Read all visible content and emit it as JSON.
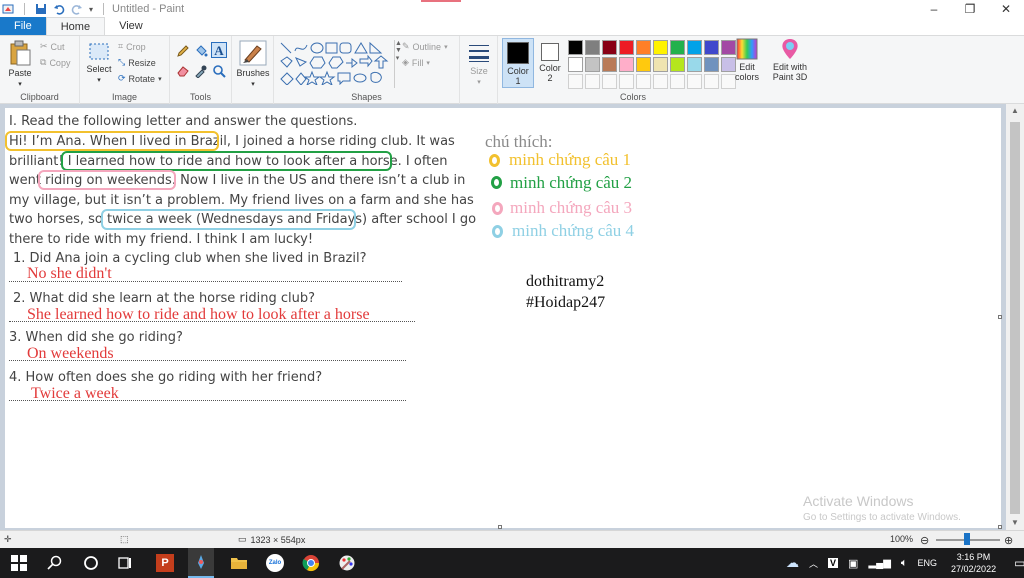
{
  "window": {
    "title": "Untitled - Paint"
  },
  "tabs": [
    {
      "label": "File"
    },
    {
      "label": "Home"
    },
    {
      "label": "View"
    }
  ],
  "ribbon": {
    "clipboard": {
      "label": "Clipboard",
      "paste": "Paste",
      "cut": "Cut",
      "copy": "Copy"
    },
    "image": {
      "label": "Image",
      "select": "Select",
      "crop": "Crop",
      "resize": "Resize",
      "rotate": "Rotate"
    },
    "tools": {
      "label": "Tools"
    },
    "brushes": {
      "label": "Brushes"
    },
    "shapes": {
      "label": "Shapes",
      "outline": "Outline",
      "fill": "Fill"
    },
    "size": {
      "label": "Size"
    },
    "colors": {
      "label": "Colors",
      "color1": "Color\n1",
      "color2": "Color\n2",
      "color1_value": "#000000",
      "color2_value": "#ffffff",
      "edit": "Edit\ncolors",
      "paint3d": "Edit with\nPaint 3D",
      "palette_row1": [
        "#000000",
        "#7f7f7f",
        "#880015",
        "#ed1c24",
        "#ff7f27",
        "#fff200",
        "#22b14c",
        "#00a2e8",
        "#3f48cc",
        "#a349a4"
      ],
      "palette_row2": [
        "#ffffff",
        "#c3c3c3",
        "#b97a57",
        "#ffaec9",
        "#ffc90e",
        "#efe4b0",
        "#b5e61d",
        "#99d9ea",
        "#7092be",
        "#c8bfe7"
      ]
    }
  },
  "document": {
    "lines": [
      "I. Read the following letter and answer the questions.",
      "Hi! I’m Ana. When I lived in Brazil, I joined a horse riding club. It was",
      "brilliant! I learned how to ride and how to look after a horse. I often",
      "went riding on weekends. Now I live in the US and there isn’t a club in",
      "my village, but it isn’t a problem. My friend lives on a farm and she has",
      "two horses, so twice a week (Wednesdays and Fridays) after school I go",
      "there to ride with my friend. I think I am lucky!"
    ],
    "questions": [
      {
        "q": "1. Did Ana join a cycling club when she lived in Brazil?",
        "a": "No she didn't"
      },
      {
        "q": "2. What did she learn at the horse riding club?",
        "a": "She learned how to ride and how to look after a horse"
      },
      {
        "q": "3. When did she go riding?",
        "a": "On weekends"
      },
      {
        "q": "4. How often does she go riding with her friend?",
        "a": "Twice a week"
      }
    ]
  },
  "legend": {
    "title": "chú thích:",
    "items": [
      {
        "label": "minh chứng câu 1",
        "color": "#f2c12e"
      },
      {
        "label": "minh chứng câu 2",
        "color": "#22a045"
      },
      {
        "label": "minh chứng câu 3",
        "color": "#f4a7bd"
      },
      {
        "label": "minh chứng câu 4",
        "color": "#8fd0e4"
      }
    ]
  },
  "signature": {
    "line1": "dothitramy2",
    "line2": "#Hoidap247"
  },
  "watermark": {
    "title": "Activate Windows",
    "subtitle": "Go to Settings to activate Windows."
  },
  "statusbar": {
    "dimensions": "1323 × 554px",
    "zoom": "100%"
  },
  "taskbar": {
    "language": "ENG",
    "time": "3:16 PM",
    "date": "27/02/2022"
  }
}
